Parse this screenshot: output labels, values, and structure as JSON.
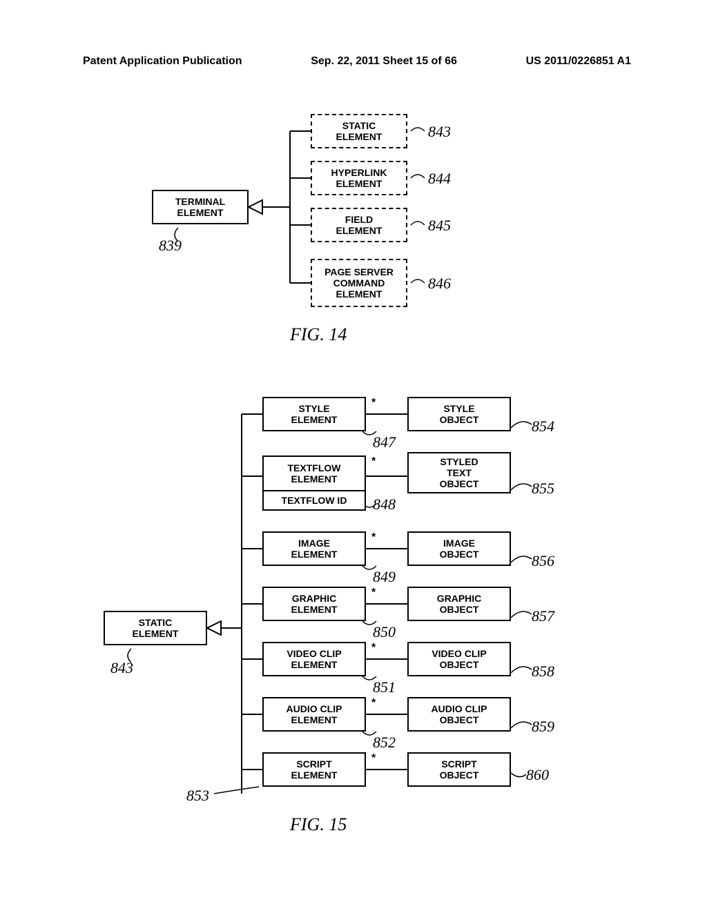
{
  "header": {
    "left": "Patent Application Publication",
    "center": "Sep. 22, 2011   Sheet 15 of 66",
    "right": "US 2011/0226851 A1"
  },
  "fig14": {
    "caption": "FIG. 14",
    "terminal": {
      "label": "TERMINAL\nELEMENT",
      "ref": "839"
    },
    "children": [
      {
        "label": "STATIC\nELEMENT",
        "ref": "843",
        "dashed": true
      },
      {
        "label": "HYPERLINK\nELEMENT",
        "ref": "844",
        "dashed": true
      },
      {
        "label": "FIELD\nELEMENT",
        "ref": "845",
        "dashed": true
      },
      {
        "label": "PAGE SERVER\nCOMMAND\nELEMENT",
        "ref": "846",
        "dashed": true
      }
    ]
  },
  "fig15": {
    "caption": "FIG. 15",
    "static": {
      "label": "STATIC\nELEMENT",
      "ref": "843"
    },
    "rows": [
      {
        "element": "STYLE\nELEMENT",
        "object": "STYLE\nOBJECT",
        "eref": "847",
        "oref": "854"
      },
      {
        "element": "TEXTFLOW\nELEMENT",
        "attr": "TEXTFLOW ID",
        "object": "STYLED\nTEXT\nOBJECT",
        "eref": "848",
        "oref": "855"
      },
      {
        "element": "IMAGE\nELEMENT",
        "object": "IMAGE\nOBJECT",
        "eref": "849",
        "oref": "856"
      },
      {
        "element": "GRAPHIC\nELEMENT",
        "object": "GRAPHIC\nOBJECT",
        "eref": "850",
        "oref": "857"
      },
      {
        "element": "VIDEO CLIP\nELEMENT",
        "object": "VIDEO CLIP\nOBJECT",
        "eref": "851",
        "oref": "858"
      },
      {
        "element": "AUDIO CLIP\nELEMENT",
        "object": "AUDIO CLIP\nOBJECT",
        "eref": "852",
        "oref": "859"
      },
      {
        "element": "SCRIPT\nELEMENT",
        "object": "SCRIPT\nOBJECT",
        "eref": "853",
        "oref": "860"
      }
    ],
    "starmark": "*"
  }
}
